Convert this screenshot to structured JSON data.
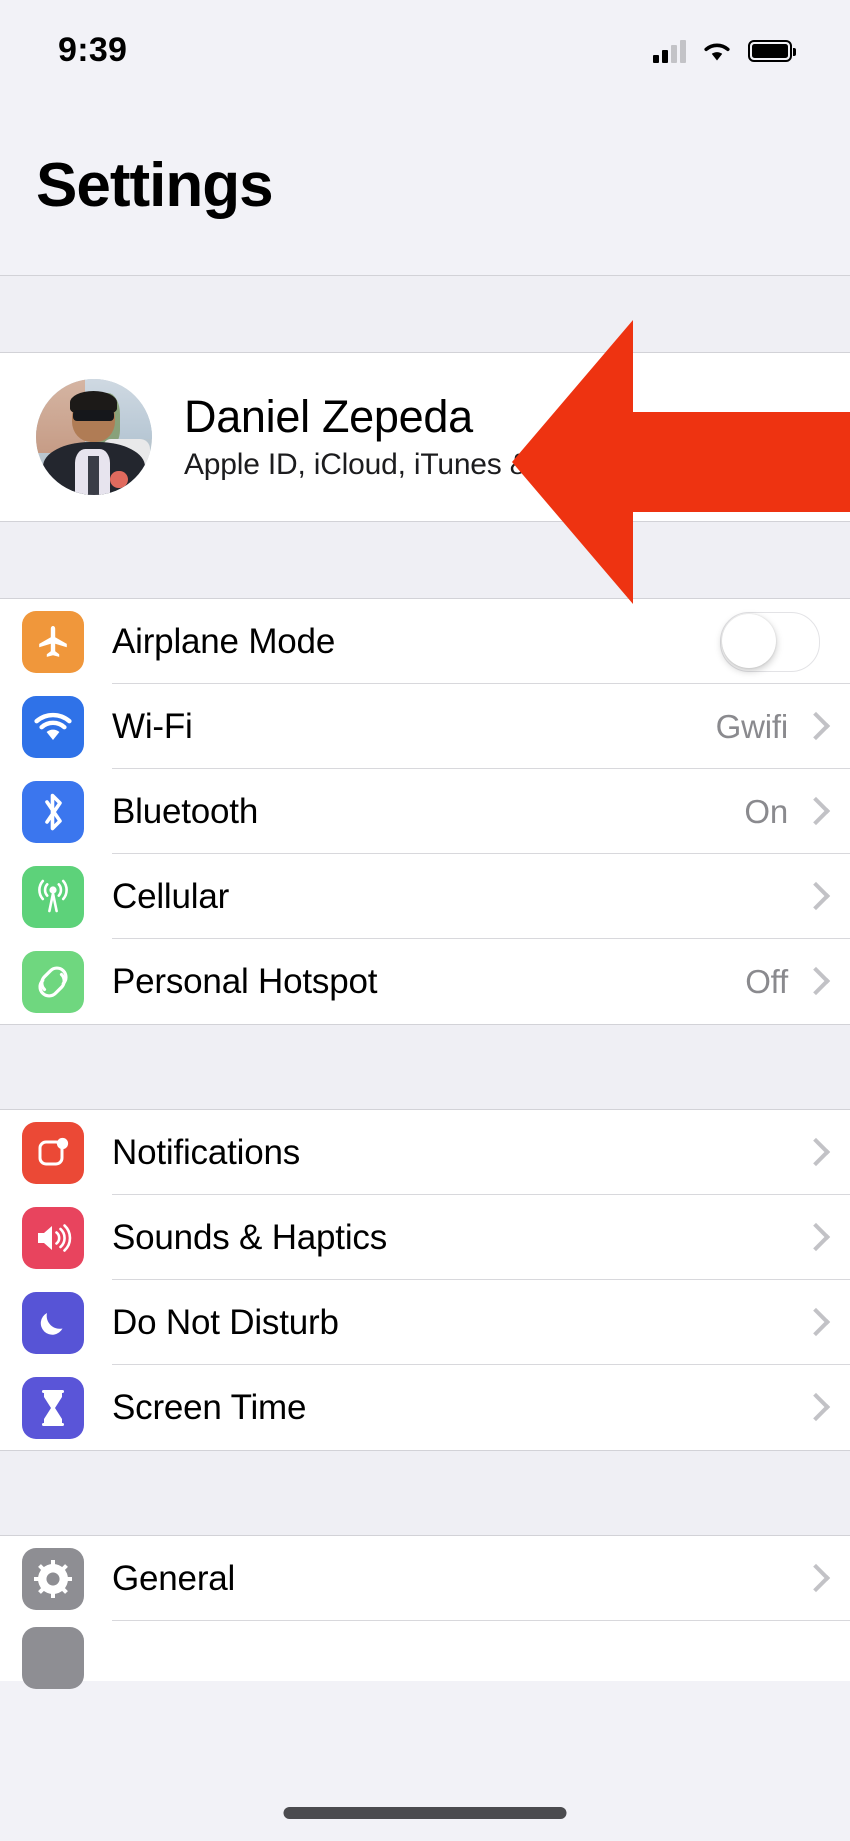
{
  "status_bar": {
    "time": "9:39",
    "cellular_icon": "cellular-signal-icon",
    "cellular_bars_filled": 2,
    "cellular_bars_total": 4,
    "wifi_icon": "wifi-icon",
    "battery_icon": "battery-full-icon",
    "battery_level": 100
  },
  "header": {
    "title": "Settings"
  },
  "profile": {
    "name": "Daniel Zepeda",
    "subtitle": "Apple ID, iCloud, iTunes & App Store",
    "avatar_icon": "user-avatar-photo",
    "chevron_icon": "chevron-right-icon"
  },
  "annotation": {
    "type": "arrow",
    "direction": "left",
    "color": "#EE3311",
    "points_at": "profile-row"
  },
  "groups": [
    {
      "id": "connectivity",
      "rows": [
        {
          "label": "Airplane Mode",
          "icon": "airplane-icon",
          "icon_color": "#F0973B",
          "accessory": "toggle",
          "toggle_on": false,
          "value": ""
        },
        {
          "label": "Wi-Fi",
          "icon": "wifi-icon",
          "icon_color": "#2F72E8",
          "accessory": "value",
          "value": "Gwifi"
        },
        {
          "label": "Bluetooth",
          "icon": "bluetooth-icon",
          "icon_color": "#3B76EE",
          "accessory": "value",
          "value": "On"
        },
        {
          "label": "Cellular",
          "icon": "cellular-antenna-icon",
          "icon_color": "#5DD27A",
          "accessory": "value",
          "value": ""
        },
        {
          "label": "Personal Hotspot",
          "icon": "hotspot-link-icon",
          "icon_color": "#6FD77F",
          "accessory": "value",
          "value": "Off"
        }
      ]
    },
    {
      "id": "alerts",
      "rows": [
        {
          "label": "Notifications",
          "icon": "notifications-badge-icon",
          "icon_color": "#EB4936",
          "accessory": "value",
          "value": ""
        },
        {
          "label": "Sounds & Haptics",
          "icon": "speaker-volume-icon",
          "icon_color": "#E8445E",
          "accessory": "value",
          "value": ""
        },
        {
          "label": "Do Not Disturb",
          "icon": "moon-icon",
          "icon_color": "#5754D6",
          "accessory": "value",
          "value": ""
        },
        {
          "label": "Screen Time",
          "icon": "hourglass-icon",
          "icon_color": "#5A55D8",
          "accessory": "value",
          "value": ""
        }
      ]
    },
    {
      "id": "system",
      "rows": [
        {
          "label": "General",
          "icon": "gear-icon",
          "icon_color": "#8E8E93",
          "accessory": "value",
          "value": ""
        }
      ]
    }
  ],
  "home_indicator": "home-indicator-bar"
}
